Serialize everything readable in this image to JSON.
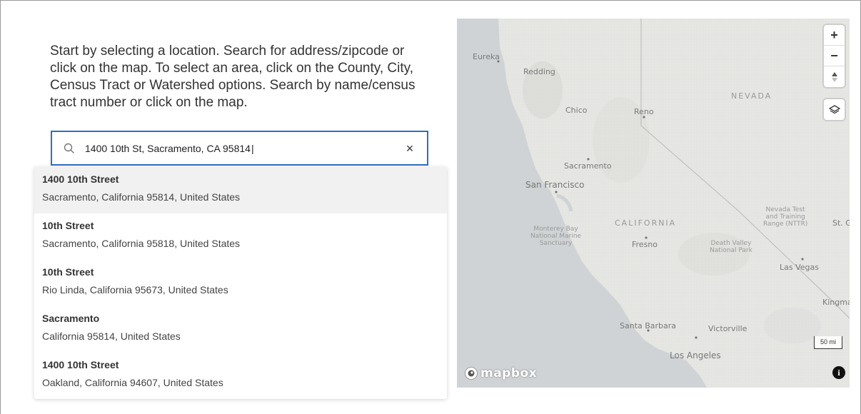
{
  "instructions": "Start by selecting a location. Search for address/zipcode or click on the map. To select an area, click on the County, City, Census Tract or Watershed options. Search by name/census tract number or click on the map.",
  "search": {
    "value": "1400 10th St, Sacramento, CA 95814",
    "icon": "search-icon",
    "clear_label": "×",
    "border_color": "#2f6ec3"
  },
  "results": [
    {
      "name": "1400 10th Street",
      "address": "Sacramento, California 95814, United States"
    },
    {
      "name": "10th Street",
      "address": "Sacramento, California 95818, United States"
    },
    {
      "name": "10th Street",
      "address": "Rio Linda, California 95673, United States"
    },
    {
      "name": "Sacramento",
      "address": "California 95814, United States"
    },
    {
      "name": "1400 10th Street",
      "address": "Oakland, California 94607, United States"
    }
  ],
  "map": {
    "labels": {
      "eureka": "Eureka",
      "redding": "Redding",
      "chico": "Chico",
      "reno": "Reno",
      "nevada": "NEVADA",
      "sacramento": "Sacramento",
      "san_francisco": "San Francisco",
      "california": "CALIFORNIA",
      "monterey": "Monterey Bay\nNational Marine\nSanctuary",
      "fresno": "Fresno",
      "death_valley": "Death Valley\nNational Park",
      "nttr": "Nevada Test\nand Training\nRange (NTTR)",
      "st_g": "St. G",
      "las_vegas": "Las Vegas",
      "kingman": "Kingma",
      "santa_barbara": "Santa Barbara",
      "victorville": "Victorville",
      "los_angeles": "Los Angeles"
    },
    "controls": {
      "zoom_in": "+",
      "zoom_out": "−",
      "compass": "▲▼",
      "layers_icon": "layers-icon"
    },
    "scale_label": "50 mi",
    "logo_text": "mapbox",
    "info_label": "i",
    "colors": {
      "land": "#e4e4e2",
      "water": "#cfd3d5"
    }
  }
}
